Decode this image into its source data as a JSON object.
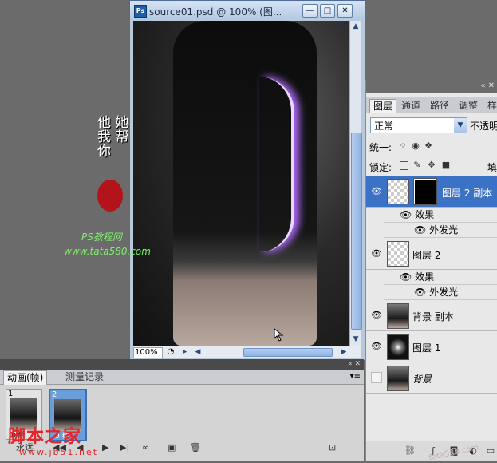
{
  "document": {
    "title": "source01.psd @ 100% (图...",
    "ps_badge": "Ps",
    "zoom": "100%",
    "buttons": {
      "minimize": "—",
      "restore": "□",
      "close": "✕"
    }
  },
  "watermark": {
    "calligraphy": "他 她 我 帮 你",
    "site_name": "PS教程网",
    "site_url": "www.tata580.com"
  },
  "bottom_logo": {
    "name": "脚本之家",
    "url": "www.jb51.net"
  },
  "right_watermark": "tata580.com",
  "layers_panel": {
    "tabs": [
      "图层",
      "通道",
      "路径",
      "调整",
      "样"
    ],
    "blend_mode": "正常",
    "opacity_label": "不透明",
    "unify_label": "统一:",
    "lock_label": "锁定:",
    "fill_label": "填",
    "layers": [
      {
        "name": "图层 2 副本",
        "visible": true,
        "selected": true,
        "effects": [
          "效果",
          "外发光"
        ]
      },
      {
        "name": "图层 2",
        "visible": true,
        "selected": false,
        "effects": [
          "效果",
          "外发光"
        ]
      },
      {
        "name": "背景 副本",
        "visible": true,
        "selected": false,
        "effects": []
      },
      {
        "name": "图层 1",
        "visible": true,
        "selected": false,
        "effects": []
      },
      {
        "name": "背景",
        "visible": false,
        "selected": false,
        "effects": []
      }
    ]
  },
  "animation_panel": {
    "tabs": [
      "动画(帧)",
      "测量记录"
    ],
    "frames": [
      {
        "number": "1",
        "delay": "0 秒"
      },
      {
        "number": "2",
        "delay": "0 秒"
      }
    ],
    "loop": "永远"
  }
}
